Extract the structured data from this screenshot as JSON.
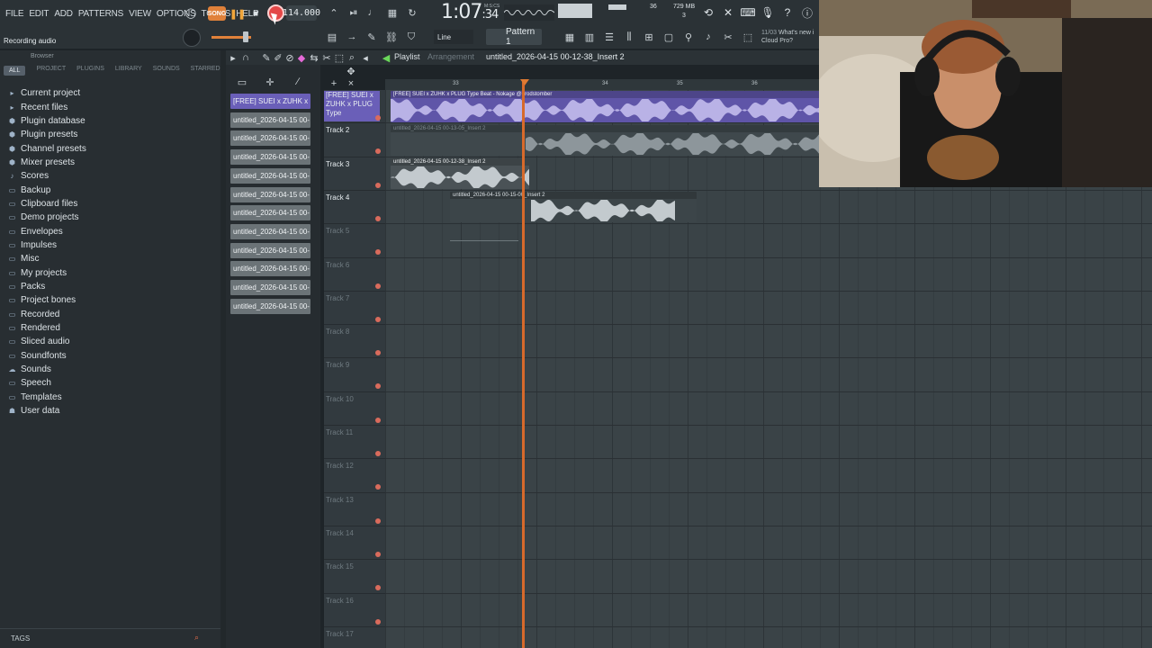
{
  "menu": [
    "FILE",
    "EDIT",
    "ADD",
    "PATTERNS",
    "VIEW",
    "OPTIONS",
    "TOOLS",
    "HELP"
  ],
  "transport": {
    "mode_label": "SONG",
    "tempo": "114.000",
    "time": "1:07",
    "time_sub": ":34",
    "time_unit": "M:S:CS",
    "memory": "729 MB",
    "polyphony": "3",
    "cpu_meter": "36"
  },
  "hint_bar": "Recording audio",
  "toolbar": {
    "snap": "Line",
    "pattern": "Pattern 1"
  },
  "news": {
    "date": "11/03",
    "headline": "What's new i",
    "sub": "Cloud Pro?"
  },
  "browser": {
    "title": "Browser",
    "tabs": [
      "ALL",
      "PROJECT",
      "PLUGINS",
      "LIBRARY",
      "SOUNDS",
      "STARRED"
    ],
    "items": [
      {
        "label": "Current project",
        "icon": "project-icon"
      },
      {
        "label": "Recent files",
        "icon": "recent-icon"
      },
      {
        "label": "Plugin database",
        "icon": "plugin-db-icon"
      },
      {
        "label": "Plugin presets",
        "icon": "plugin-presets-icon"
      },
      {
        "label": "Channel presets",
        "icon": "channel-presets-icon"
      },
      {
        "label": "Mixer presets",
        "icon": "mixer-presets-icon"
      },
      {
        "label": "Scores",
        "icon": "scores-icon"
      },
      {
        "label": "Backup",
        "icon": "folder-icon"
      },
      {
        "label": "Clipboard files",
        "icon": "folder-icon"
      },
      {
        "label": "Demo projects",
        "icon": "folder-icon"
      },
      {
        "label": "Envelopes",
        "icon": "folder-icon"
      },
      {
        "label": "Impulses",
        "icon": "folder-icon"
      },
      {
        "label": "Misc",
        "icon": "folder-icon"
      },
      {
        "label": "My projects",
        "icon": "folder-icon"
      },
      {
        "label": "Packs",
        "icon": "folder-icon"
      },
      {
        "label": "Project bones",
        "icon": "folder-icon"
      },
      {
        "label": "Recorded",
        "icon": "folder-icon"
      },
      {
        "label": "Rendered",
        "icon": "folder-icon"
      },
      {
        "label": "Sliced audio",
        "icon": "folder-icon"
      },
      {
        "label": "Soundfonts",
        "icon": "folder-icon"
      },
      {
        "label": "Sounds",
        "icon": "cloud-icon"
      },
      {
        "label": "Speech",
        "icon": "folder-icon"
      },
      {
        "label": "Templates",
        "icon": "folder-icon"
      },
      {
        "label": "User data",
        "icon": "user-icon"
      }
    ],
    "tags_label": "TAGS"
  },
  "playlist": {
    "title": "Playlist",
    "subtitle": "Arrangement",
    "path": "untitled_2026-04-15 00-12-38_Insert 2",
    "clip_list": [
      "[FREE] SUEI x ZUHK x",
      "untitled_2026-04-15 00-",
      "untitled_2026-04-15 00-",
      "untitled_2026-04-15 00-",
      "untitled_2026-04-15 00-",
      "untitled_2026-04-15 00-",
      "untitled_2026-04-15 00-",
      "untitled_2026-04-15 00-",
      "untitled_2026-04-15 00-",
      "untitled_2026-04-15 00-",
      "untitled_2026-04-15 00-",
      "untitled_2026-04-15 00-"
    ],
    "ruler_marks": [
      "33",
      "34",
      "35",
      "36"
    ],
    "tracks": [
      "[FREE] SUEI x ZUHK x PLUG Type",
      "Track 2",
      "Track 3",
      "Track 4",
      "Track 5",
      "Track 6",
      "Track 7",
      "Track 8",
      "Track 9",
      "Track 10",
      "Track 11",
      "Track 12",
      "Track 13",
      "Track 14",
      "Track 15",
      "Track 16",
      "Track 17"
    ],
    "clips": [
      {
        "name": "[FREE] SUEI x ZUHK x PLUG Type Beat - Nokage @prodstomber"
      },
      {
        "name": "untitled_2026-04-15 00-13-05_Insert 2"
      },
      {
        "name": "untitled_2026-04-15 00-12-38_Insert 2"
      },
      {
        "name": "untitled_2026-04-15 00-15-00_Insert 2"
      }
    ]
  }
}
